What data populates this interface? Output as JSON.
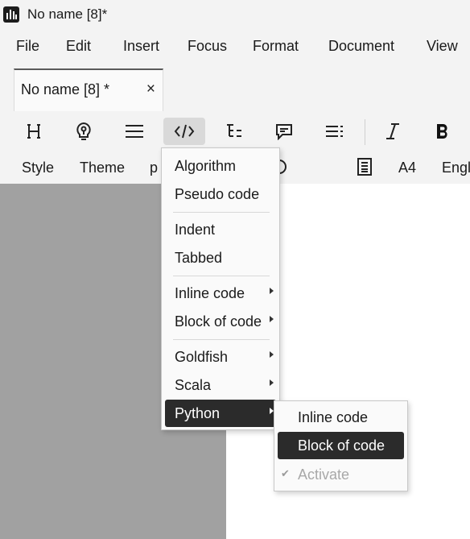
{
  "window": {
    "title": "No name [8]*"
  },
  "menubar": {
    "items": [
      "File",
      "Edit",
      "Insert",
      "Focus",
      "Format",
      "Document",
      "View"
    ]
  },
  "tab": {
    "title": "No name [8] *",
    "close": "×"
  },
  "toolbar": {
    "icons": [
      "heading-icon",
      "idea-icon",
      "paragraph-icon",
      "code-icon",
      "outline-icon",
      "comment-icon",
      "list-icon",
      "italic-icon",
      "bold-icon"
    ],
    "active": "code-icon"
  },
  "toolbar2": {
    "style": "Style",
    "theme": "Theme",
    "partial": "p",
    "page_size": "A4",
    "language": "Engl"
  },
  "code_menu": {
    "items": [
      "Algorithm",
      "Pseudo code",
      "Indent",
      "Tabbed",
      "Inline code",
      "Block of code",
      "Goldfish",
      "Scala",
      "Python"
    ],
    "highlighted": "Python"
  },
  "python_submenu": {
    "items": [
      "Inline code",
      "Block of code",
      "Activate"
    ],
    "highlighted": "Block of code",
    "disabled": "Activate",
    "checkmark": "✔"
  },
  "colors": {
    "highlight": "#2b2b2b",
    "workspace": "#a1a1a1",
    "page": "#ffffff"
  }
}
